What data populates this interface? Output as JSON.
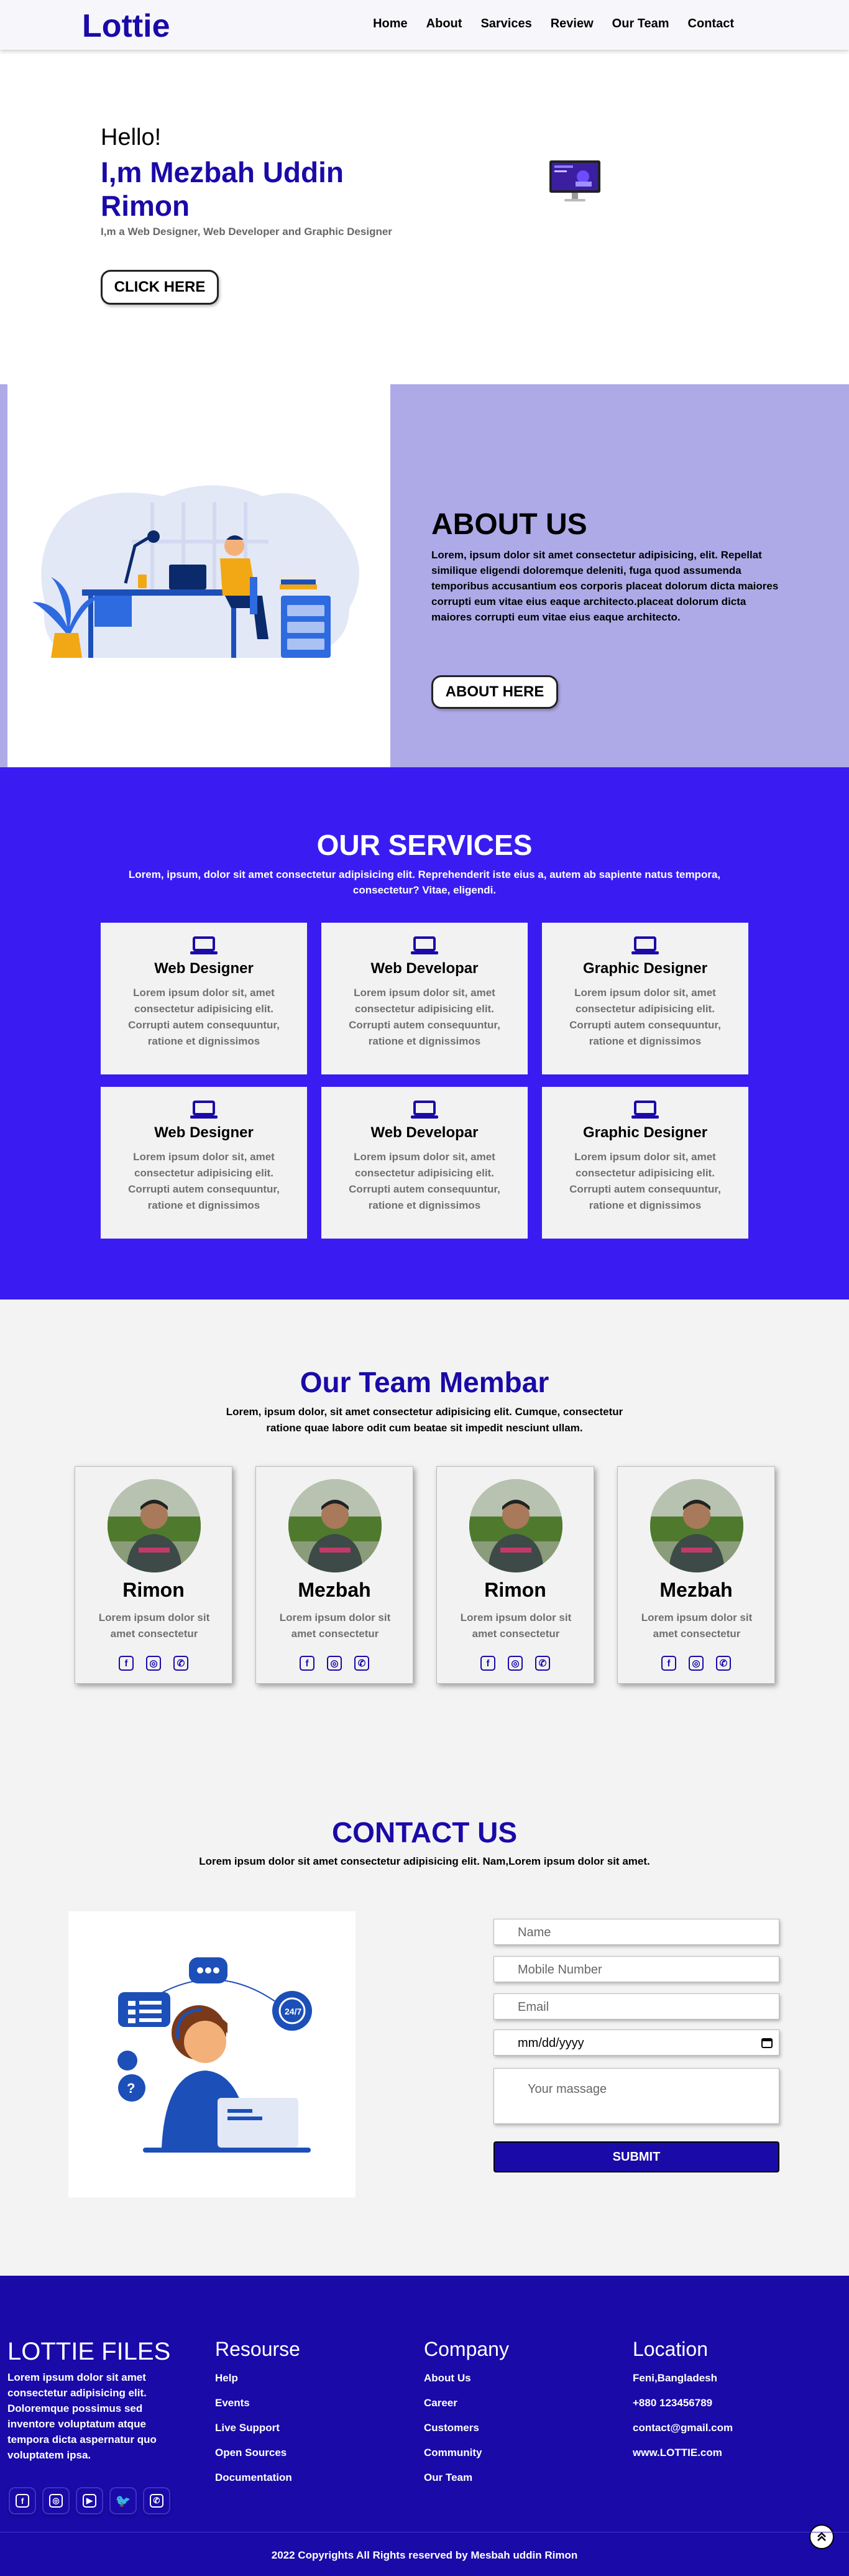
{
  "nav": {
    "logo": "Lottie",
    "items": [
      "Home",
      "About",
      "Sarvices",
      "Review",
      "Our Team",
      "Contact"
    ]
  },
  "hero": {
    "greeting": "Hello!",
    "title": "I,m Mezbah Uddin Rimon",
    "subtitle": "I,m a Web Designer, Web Developer and Graphic Designer",
    "button": "CLICK HERE"
  },
  "about": {
    "heading": "ABOUT US",
    "text": "Lorem, ipsum dolor sit amet consectetur adipisicing, elit. Repellat similique eligendi doloremque deleniti, fuga quod assumenda temporibus accusantium eos corporis placeat dolorum dicta maiores corrupti eum vitae eius eaque architecto.placeat dolorum dicta maiores corrupti eum vitae eius eaque architecto.",
    "button": "ABOUT HERE"
  },
  "services": {
    "heading": "OUR SERVICES",
    "text": "Lorem, ipsum, dolor sit amet consectetur adipisicing elit. Reprehenderit iste eius a, autem ab sapiente natus tempora, consectetur? Vitae, eligendi.",
    "cards": [
      {
        "title": "Web Designer",
        "text": "Lorem ipsum dolor sit, amet consectetur adipisicing elit. Corrupti autem consequuntur, ratione et dignissimos"
      },
      {
        "title": "Web Developar",
        "text": "Lorem ipsum dolor sit, amet consectetur adipisicing elit. Corrupti autem consequuntur, ratione et dignissimos"
      },
      {
        "title": "Graphic Designer",
        "text": "Lorem ipsum dolor sit, amet consectetur adipisicing elit. Corrupti autem consequuntur, ratione et dignissimos"
      },
      {
        "title": "Web Designer",
        "text": "Lorem ipsum dolor sit, amet consectetur adipisicing elit. Corrupti autem consequuntur, ratione et dignissimos"
      },
      {
        "title": "Web Developar",
        "text": "Lorem ipsum dolor sit, amet consectetur adipisicing elit. Corrupti autem consequuntur, ratione et dignissimos"
      },
      {
        "title": "Graphic Designer",
        "text": "Lorem ipsum dolor sit, amet consectetur adipisicing elit. Corrupti autem consequuntur, ratione et dignissimos"
      }
    ]
  },
  "team": {
    "heading": "Our Team Membar",
    "text": "Lorem, ipsum dolor, sit amet consectetur adipisicing elit. Cumque, consectetur ratione quae labore odit cum beatae sit impedit nesciunt ullam.",
    "members": [
      {
        "name": "Rimon",
        "text": "Lorem ipsum dolor sit amet consectetur"
      },
      {
        "name": "Mezbah",
        "text": "Lorem ipsum dolor sit amet consectetur"
      },
      {
        "name": "Rimon",
        "text": "Lorem ipsum dolor sit amet consectetur"
      },
      {
        "name": "Mezbah",
        "text": "Lorem ipsum dolor sit amet consectetur"
      }
    ]
  },
  "contact": {
    "heading": "CONTACT US",
    "text": "Lorem ipsum dolor sit amet consectetur adipisicing elit. Nam,Lorem ipsum dolor sit amet.",
    "name_placeholder": "Name",
    "mobile_placeholder": "Mobile Number",
    "email_placeholder": "Email",
    "date_placeholder": "mm/dd/yyyy",
    "message_placeholder": "Your massage",
    "submit": "SUBMIT"
  },
  "footer": {
    "brand": "LOTTIE FILES",
    "brand_text": "Lorem ipsum dolor sit amet consectetur adipisicing elit. Doloremque possimus sed inventore voluptatum atque tempora dicta aspernatur quo voluptatem ipsa.",
    "resource_heading": "Resourse",
    "resource_items": [
      "Help",
      "Events",
      "Live Support",
      "Open Sources",
      "Documentation"
    ],
    "company_heading": "Company",
    "company_items": [
      "About Us",
      "Career",
      "Customers",
      "Community",
      "Our Team"
    ],
    "location_heading": "Location",
    "location_items": [
      "Feni,Bangladesh",
      "+880 123456789",
      "contact@gmail.com",
      "www.LOTTIE.com"
    ],
    "copyright": "2022 Copyrights All Rights reserved by Mesbah uddin Rimon"
  },
  "colors": {
    "brand": "#1a0aa8",
    "services_bg": "#3a1cf2",
    "about_bg": "#aeaae8"
  }
}
